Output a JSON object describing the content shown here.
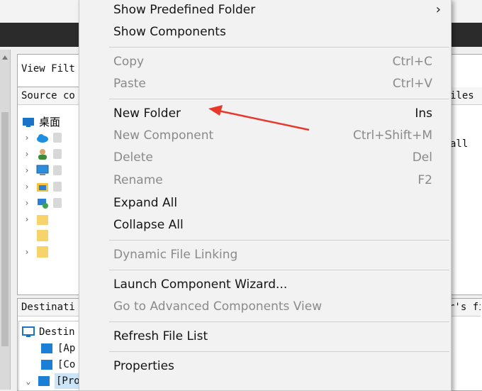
{
  "background": {
    "view_filter_label": "View Filt",
    "source_label": "Source co",
    "files_label": "iles",
    "all_label": "all",
    "destination_label": "Destinati",
    "right_frag_label": "r's fi",
    "tree_root_label": "桌面",
    "dest_root_label": "Destin",
    "dest_items": [
      "[Ap",
      "[Co",
      "[ProgramFilesFolder]"
    ]
  },
  "menu": {
    "items": [
      {
        "label": "Show Predefined Folder",
        "shortcut": "",
        "submenu": "›",
        "enabled": true
      },
      {
        "label": "Show Components",
        "shortcut": "",
        "enabled": true
      },
      {
        "label": "Copy",
        "shortcut": "Ctrl+C",
        "enabled": false
      },
      {
        "label": "Paste",
        "shortcut": "Ctrl+V",
        "enabled": false
      },
      {
        "label": "New Folder",
        "shortcut": "Ins",
        "enabled": true
      },
      {
        "label": "New Component",
        "shortcut": "Ctrl+Shift+M",
        "enabled": false
      },
      {
        "label": "Delete",
        "shortcut": "Del",
        "enabled": false
      },
      {
        "label": "Rename",
        "shortcut": "F2",
        "enabled": false
      },
      {
        "label": "Expand All",
        "shortcut": "",
        "enabled": true
      },
      {
        "label": "Collapse All",
        "shortcut": "",
        "enabled": true
      },
      {
        "label": "Dynamic File Linking",
        "shortcut": "",
        "enabled": false
      },
      {
        "label": "Launch Component Wizard...",
        "shortcut": "",
        "enabled": true
      },
      {
        "label": "Go to Advanced Components View",
        "shortcut": "",
        "enabled": false
      },
      {
        "label": "Refresh File List",
        "shortcut": "",
        "enabled": true
      },
      {
        "label": "Properties",
        "shortcut": "",
        "enabled": true
      }
    ]
  },
  "colors": {
    "annotation_arrow": "#e8382c",
    "menu_bg": "#f2f2f2",
    "disabled_text": "#8a8a8a"
  }
}
